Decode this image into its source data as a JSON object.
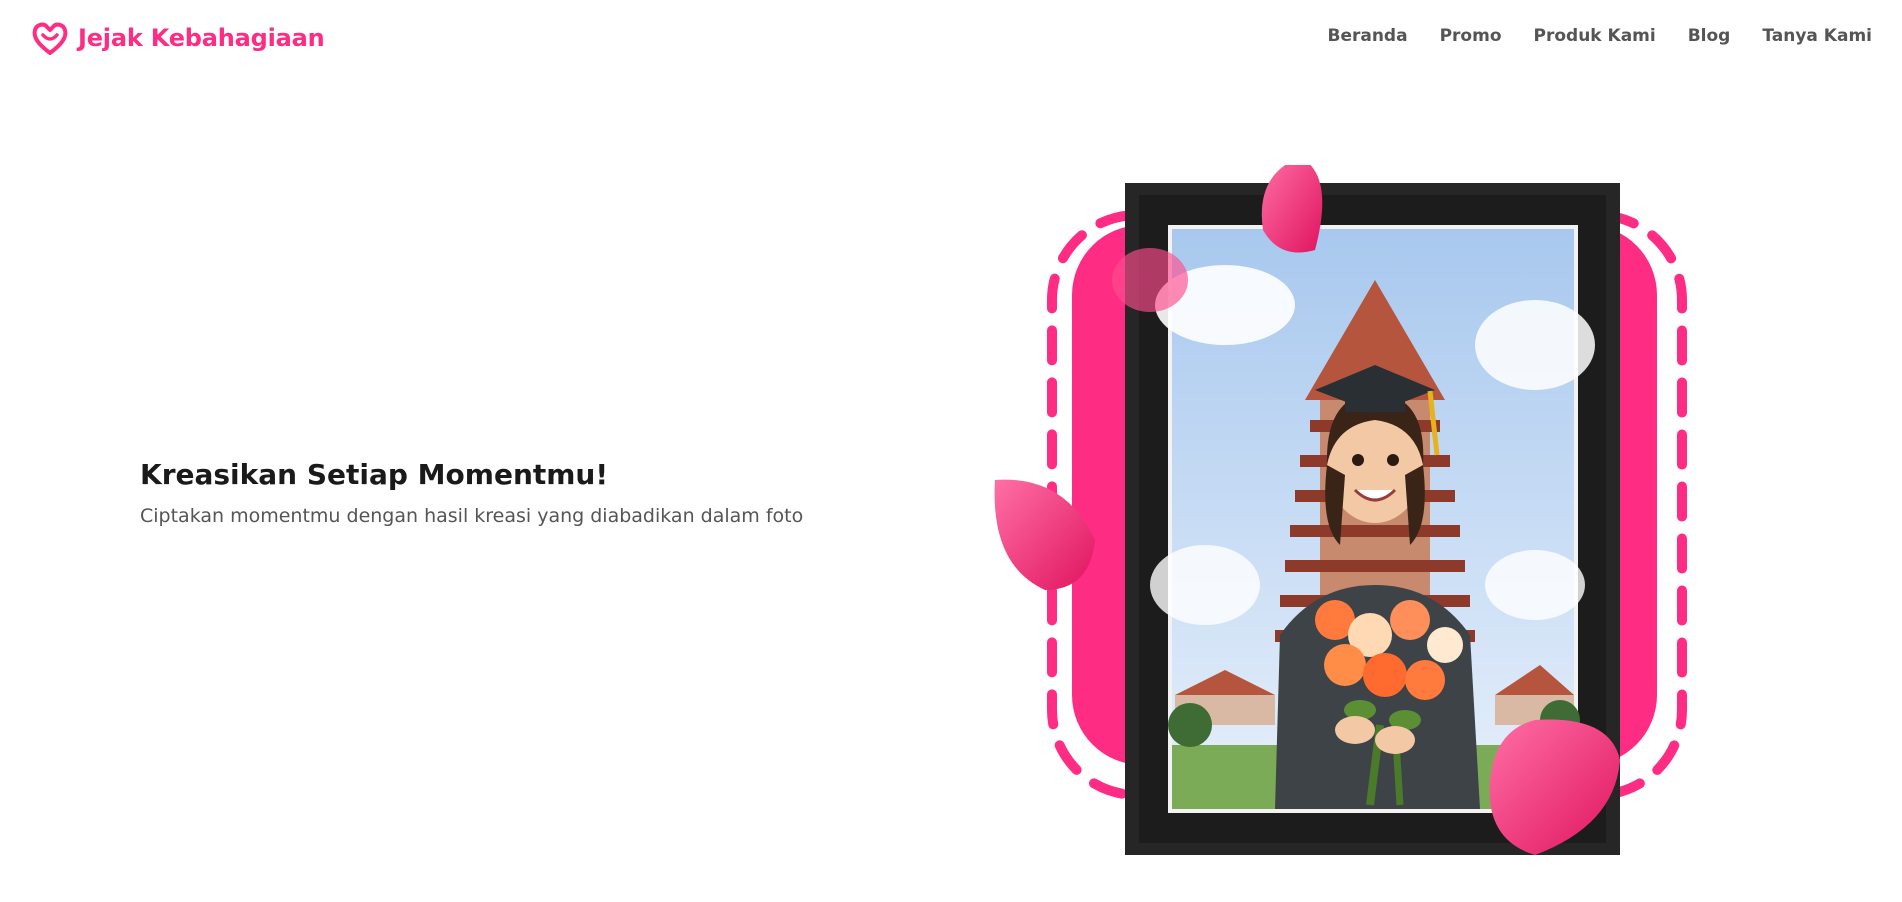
{
  "brand": {
    "name": "Jejak Kebahagiaan",
    "color": "#ff2c84",
    "logo_icon": "heart-smile-icon"
  },
  "nav": {
    "items": [
      {
        "label": "Beranda"
      },
      {
        "label": "Promo"
      },
      {
        "label": "Produk Kami"
      },
      {
        "label": "Blog"
      },
      {
        "label": "Tanya Kami"
      }
    ]
  },
  "hero": {
    "title": "Kreasikan Setiap Momentmu!",
    "subtitle": "Ciptakan momentmu dengan hasil kreasi yang diabadikan dalam foto"
  },
  "illustration": {
    "accent_color": "#ff2c84",
    "frame_color": "#222222",
    "subject": "graduate-with-bouquet"
  }
}
